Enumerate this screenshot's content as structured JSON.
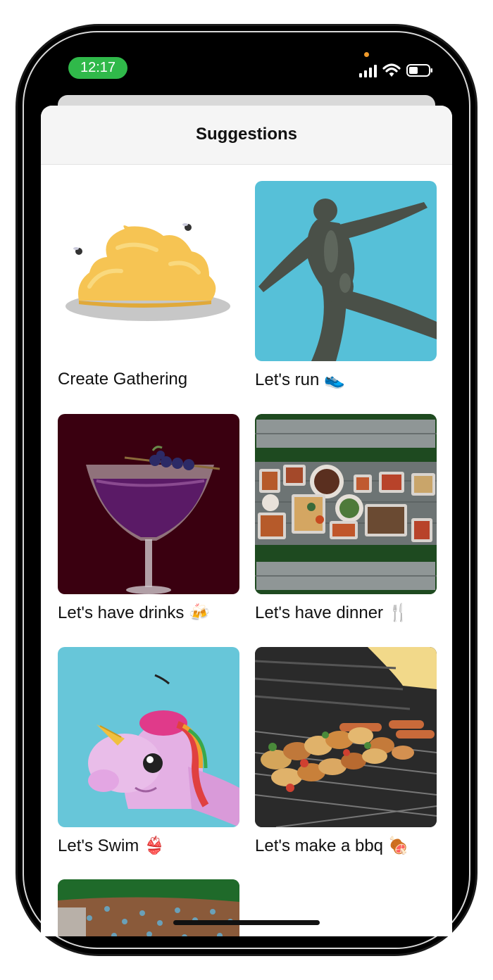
{
  "status_bar": {
    "time": "12:17"
  },
  "sheet": {
    "title": "Suggestions"
  },
  "suggestions": [
    {
      "label": "Create Gathering",
      "emoji": ""
    },
    {
      "label": "Let's run",
      "emoji": "👟"
    },
    {
      "label": "Let's have drinks",
      "emoji": "🍻"
    },
    {
      "label": "Let's have dinner",
      "emoji": "🍴"
    },
    {
      "label": "Let's Swim",
      "emoji": "👙"
    },
    {
      "label": "Let's make a bbq",
      "emoji": "🍖"
    }
  ],
  "colors": {
    "time_pill": "#30b94a",
    "run_bg": "#56c0d8",
    "drinks_bg": "#3a0010",
    "dinner_bg": "#1e4a20",
    "swim_bg": "#67c6d9",
    "bbq_bg": "#2a2a2a"
  },
  "icons": [
    "signal-icon",
    "wifi-icon",
    "battery-icon"
  ]
}
